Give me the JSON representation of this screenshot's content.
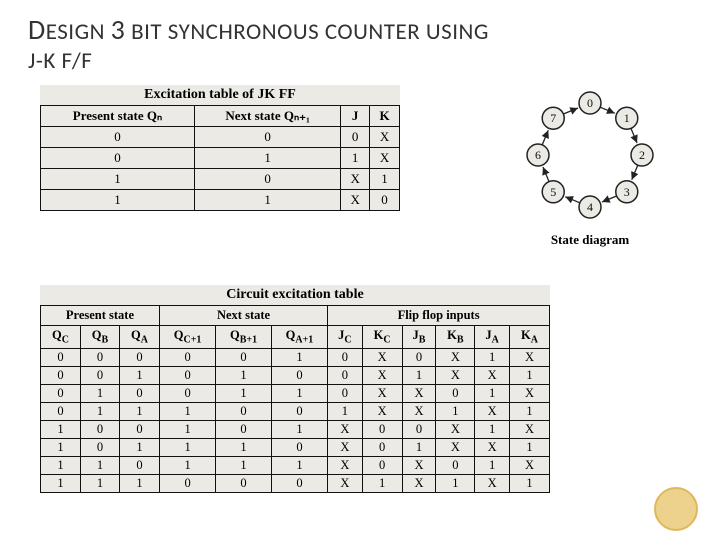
{
  "title": {
    "d": "D",
    "esign": "ESIGN ",
    "three": "3",
    "rest": " BIT SYNCHRONOUS COUNTER USING",
    "line2": "J-K  F/F"
  },
  "excite": {
    "title": "Excitation table of JK FF",
    "headers": [
      "Present state Qₙ",
      "Next state Qₙ₊₁",
      "J",
      "K"
    ],
    "rows": [
      [
        "0",
        "0",
        "0",
        "X"
      ],
      [
        "0",
        "1",
        "1",
        "X"
      ],
      [
        "1",
        "0",
        "X",
        "1"
      ],
      [
        "1",
        "1",
        "X",
        "0"
      ]
    ]
  },
  "state_diagram": {
    "caption": "State diagram",
    "nodes": [
      "0",
      "1",
      "2",
      "3",
      "4",
      "5",
      "6",
      "7"
    ]
  },
  "circuit": {
    "title": "Circuit excitation table",
    "group_headers": [
      "Present state",
      "Next state",
      "Flip flop inputs"
    ],
    "sub_headers": [
      "Q_C",
      "Q_B",
      "Q_A",
      "Q_C+1",
      "Q_B+1",
      "Q_A+1",
      "J_C",
      "K_C",
      "J_B",
      "K_B",
      "J_A",
      "K_A"
    ],
    "rows": [
      [
        "0",
        "0",
        "0",
        "0",
        "0",
        "1",
        "0",
        "X",
        "0",
        "X",
        "1",
        "X"
      ],
      [
        "0",
        "0",
        "1",
        "0",
        "1",
        "0",
        "0",
        "X",
        "1",
        "X",
        "X",
        "1"
      ],
      [
        "0",
        "1",
        "0",
        "0",
        "1",
        "1",
        "0",
        "X",
        "X",
        "0",
        "1",
        "X"
      ],
      [
        "0",
        "1",
        "1",
        "1",
        "0",
        "0",
        "1",
        "X",
        "X",
        "1",
        "X",
        "1"
      ],
      [
        "1",
        "0",
        "0",
        "1",
        "0",
        "1",
        "X",
        "0",
        "0",
        "X",
        "1",
        "X"
      ],
      [
        "1",
        "0",
        "1",
        "1",
        "1",
        "0",
        "X",
        "0",
        "1",
        "X",
        "X",
        "1"
      ],
      [
        "1",
        "1",
        "0",
        "1",
        "1",
        "1",
        "X",
        "0",
        "X",
        "0",
        "1",
        "X"
      ],
      [
        "1",
        "1",
        "1",
        "0",
        "0",
        "0",
        "X",
        "1",
        "X",
        "1",
        "X",
        "1"
      ]
    ]
  },
  "chart_data": {
    "type": "table",
    "tables": [
      {
        "name": "JK Excitation",
        "columns": [
          "Qn",
          "Qn+1",
          "J",
          "K"
        ],
        "rows": [
          [
            0,
            0,
            0,
            "X"
          ],
          [
            0,
            1,
            1,
            "X"
          ],
          [
            1,
            0,
            "X",
            1
          ],
          [
            1,
            1,
            "X",
            0
          ]
        ]
      },
      {
        "name": "Circuit Excitation",
        "columns": [
          "QC",
          "QB",
          "QA",
          "QC+1",
          "QB+1",
          "QA+1",
          "JC",
          "KC",
          "JB",
          "KB",
          "JA",
          "KA"
        ],
        "rows": [
          [
            0,
            0,
            0,
            0,
            0,
            1,
            0,
            "X",
            0,
            "X",
            1,
            "X"
          ],
          [
            0,
            0,
            1,
            0,
            1,
            0,
            0,
            "X",
            1,
            "X",
            "X",
            1
          ],
          [
            0,
            1,
            0,
            0,
            1,
            1,
            0,
            "X",
            "X",
            0,
            1,
            "X"
          ],
          [
            0,
            1,
            1,
            1,
            0,
            0,
            1,
            "X",
            "X",
            1,
            "X",
            1
          ],
          [
            1,
            0,
            0,
            1,
            0,
            1,
            "X",
            0,
            0,
            "X",
            1,
            "X"
          ],
          [
            1,
            0,
            1,
            1,
            1,
            0,
            "X",
            0,
            1,
            "X",
            "X",
            1
          ],
          [
            1,
            1,
            0,
            1,
            1,
            1,
            "X",
            0,
            "X",
            0,
            1,
            "X"
          ],
          [
            1,
            1,
            1,
            0,
            0,
            0,
            "X",
            1,
            "X",
            1,
            "X",
            1
          ]
        ]
      }
    ],
    "diagram": {
      "type": "cycle",
      "nodes": [
        0,
        1,
        2,
        3,
        4,
        5,
        6,
        7
      ],
      "edges": [
        [
          0,
          1
        ],
        [
          1,
          2
        ],
        [
          2,
          3
        ],
        [
          3,
          4
        ],
        [
          4,
          5
        ],
        [
          5,
          6
        ],
        [
          6,
          7
        ],
        [
          7,
          0
        ]
      ]
    }
  }
}
